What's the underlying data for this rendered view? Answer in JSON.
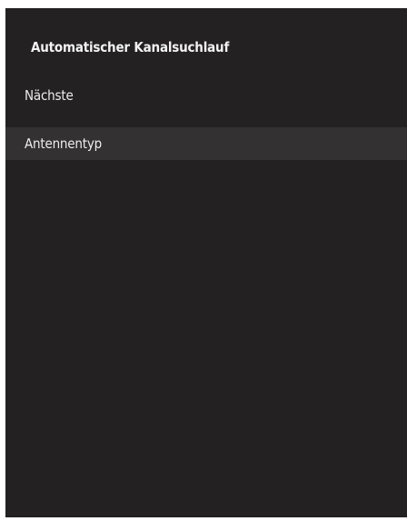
{
  "screen": {
    "title": "Automatischer Kanalsuchlauf"
  },
  "menu": {
    "items": [
      {
        "label": "Nächste",
        "selected": false
      },
      {
        "label": "Antennentyp",
        "selected": true
      }
    ]
  },
  "colors": {
    "panel_background": "#232121",
    "highlight_background": "#333131",
    "text": "#f2f2f2"
  }
}
